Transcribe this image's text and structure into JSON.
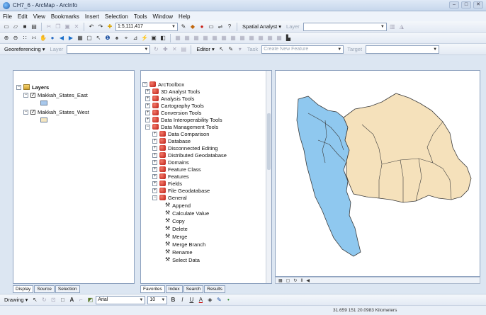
{
  "window": {
    "title": "CH7_6 - ArcMap - ArcInfo"
  },
  "menu": [
    "File",
    "Edit",
    "View",
    "Bookmarks",
    "Insert",
    "Selection",
    "Tools",
    "Window",
    "Help"
  ],
  "toolbar1": {
    "scale_value": "1:5,111,417",
    "spatial_analyst_label": "Spatial Analyst ▾",
    "layer_label": "Layer"
  },
  "toolbar3": {
    "georeferencing_label": "Georeferencing ▾",
    "layer_label": "Layer",
    "editor_label": "Editor ▾",
    "task_label": "Task",
    "task_value": "Create New Feature",
    "target_label": "Target"
  },
  "toc": {
    "root": "Layers",
    "layers": [
      {
        "name": "Makkah_States_East",
        "checked": true,
        "swatch": "#a8c8ec"
      },
      {
        "name": "Makkah_States_West",
        "checked": true,
        "swatch": "#f5e6c0"
      }
    ]
  },
  "toolbox": {
    "root": "ArcToolbox",
    "tools": [
      "3D Analyst Tools",
      "Analysis Tools",
      "Cartography Tools",
      "Conversion Tools",
      "Data Interoperability Tools",
      "Data Management Tools"
    ],
    "dm_children": [
      "Data Comparison",
      "Database",
      "Disconnected Editing",
      "Distributed Geodatabase",
      "Domains",
      "Feature Class",
      "Features",
      "Fields",
      "File Geodatabase",
      "General"
    ],
    "general_children": [
      "Append",
      "Calculate Value",
      "Copy",
      "Delete",
      "Merge",
      "Merge Branch",
      "Rename",
      "Select Data"
    ]
  },
  "toc_tabs": [
    "Display",
    "Source",
    "Selection"
  ],
  "toolbox_tabs": [
    "Favorites",
    "Index",
    "Search",
    "Results"
  ],
  "drawbar": {
    "drawing_label": "Drawing ▾",
    "font_value": "Arial",
    "size_value": "10"
  },
  "status": {
    "coords": "31.659 151 20.0983 Kilometers"
  },
  "colors": {
    "east_fill": "#f5e1bb",
    "west_fill": "#8fc8ef",
    "boundary": "#3b3b3b"
  }
}
